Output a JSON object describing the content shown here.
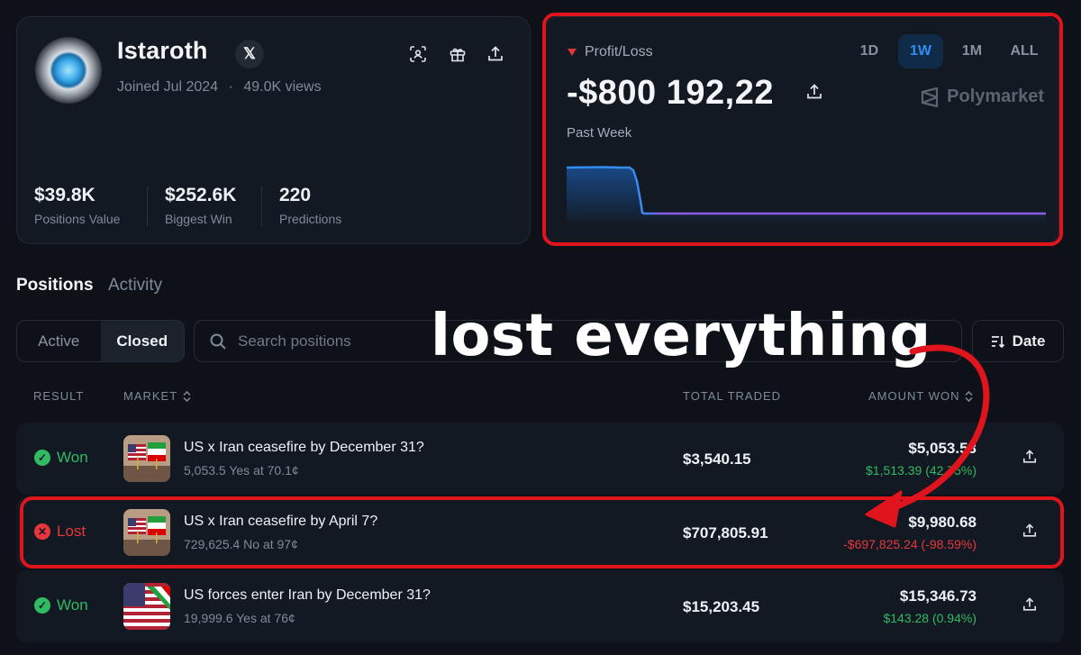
{
  "profile": {
    "username": "Istaroth",
    "x_badge": "𝕏",
    "joined": "Joined Jul 2024",
    "views_separator": "·",
    "views": "49.0K views",
    "stats": [
      {
        "value": "$39.8K",
        "label": "Positions Value"
      },
      {
        "value": "$252.6K",
        "label": "Biggest Win"
      },
      {
        "value": "220",
        "label": "Predictions"
      }
    ],
    "icons": [
      "scan-icon",
      "gift-icon",
      "share-icon"
    ]
  },
  "pnl": {
    "label": "Profit/Loss",
    "ranges": [
      "1D",
      "1W",
      "1M",
      "ALL"
    ],
    "active_range": "1W",
    "value": "-$800 192,22",
    "brand": "Polymarket",
    "period": "Past Week"
  },
  "tabs": {
    "positions": "Positions",
    "activity": "Activity"
  },
  "filter": {
    "active": "Active",
    "closed": "Closed",
    "selected": "Closed"
  },
  "search": {
    "placeholder": "Search positions"
  },
  "sort": {
    "label": "Date"
  },
  "overlay": {
    "text": "lost everything"
  },
  "table": {
    "headers": {
      "result": "RESULT",
      "market": "MARKET",
      "total_traded": "TOTAL TRADED",
      "amount_won": "AMOUNT WON"
    },
    "rows": [
      {
        "result": "Won",
        "title": "US x Iran ceasefire by December 31?",
        "sub": "5,053.5 Yes at 70.1¢",
        "traded": "$3,540.15",
        "won": "$5,053.53",
        "delta": "$1,513.39 (42.75%)"
      },
      {
        "result": "Lost",
        "title": "US x Iran ceasefire by April 7?",
        "sub": "729,625.4 No at 97¢",
        "traded": "$707,805.91",
        "won": "$9,980.68",
        "delta": "-$697,825.24 (-98.59%)"
      },
      {
        "result": "Won",
        "title": "US forces enter Iran by December 31?",
        "sub": "19,999.6 Yes at 76¢",
        "traded": "$15,203.45",
        "won": "$15,346.73",
        "delta": "$143.28 (0.94%)"
      }
    ]
  },
  "colors": {
    "won": "#2fba63",
    "lost": "#e8373c",
    "accent": "#2f8cf0",
    "highlight": "#e0141c",
    "background": "#0e1218"
  }
}
